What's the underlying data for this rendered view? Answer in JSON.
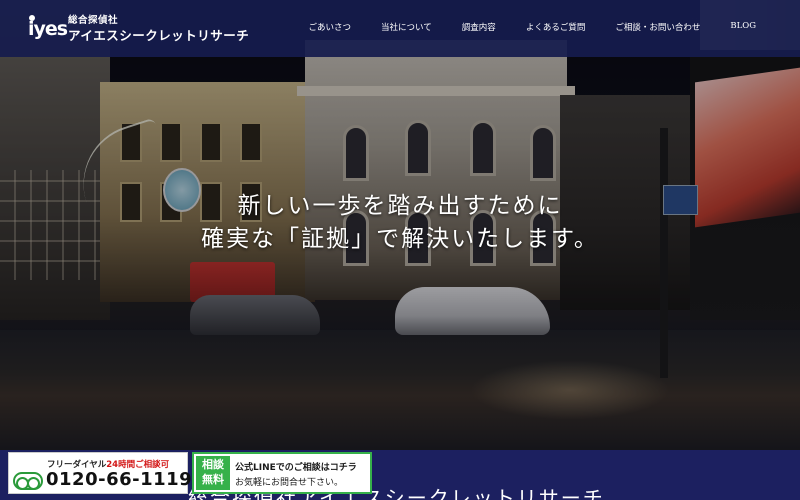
{
  "header": {
    "logo_mark": "iyes",
    "logo_sub": "総合探偵社",
    "logo_main": "アイエスシークレットリサーチ",
    "nav": [
      {
        "label": "ごあいさつ"
      },
      {
        "label": "当社について"
      },
      {
        "label": "調査内容"
      },
      {
        "label": "よくあるご質問"
      },
      {
        "label": "ご相談・お問い合わせ"
      },
      {
        "label": "BLOG"
      }
    ]
  },
  "hero": {
    "line1": "新しい一歩を踏み出すために",
    "line2": "確実な「証拠」で解決いたします。"
  },
  "footer": {
    "title": "総合探偵社アイエスシークレットリサーチ"
  },
  "cta_phone": {
    "label_prefix": "フリーダイヤル",
    "label_highlight": "24時間ご相談可",
    "number": "0120-66-1119"
  },
  "cta_line": {
    "badge": "相談無料",
    "text1": "公式LINEでのご相談はコチラ",
    "text2": "お気軽にお問合せ下さい。"
  },
  "colors": {
    "header_bg": "#161c4e",
    "bottom_bg": "#1c2060",
    "line_green": "#36b14a",
    "highlight_red": "#d21414"
  }
}
